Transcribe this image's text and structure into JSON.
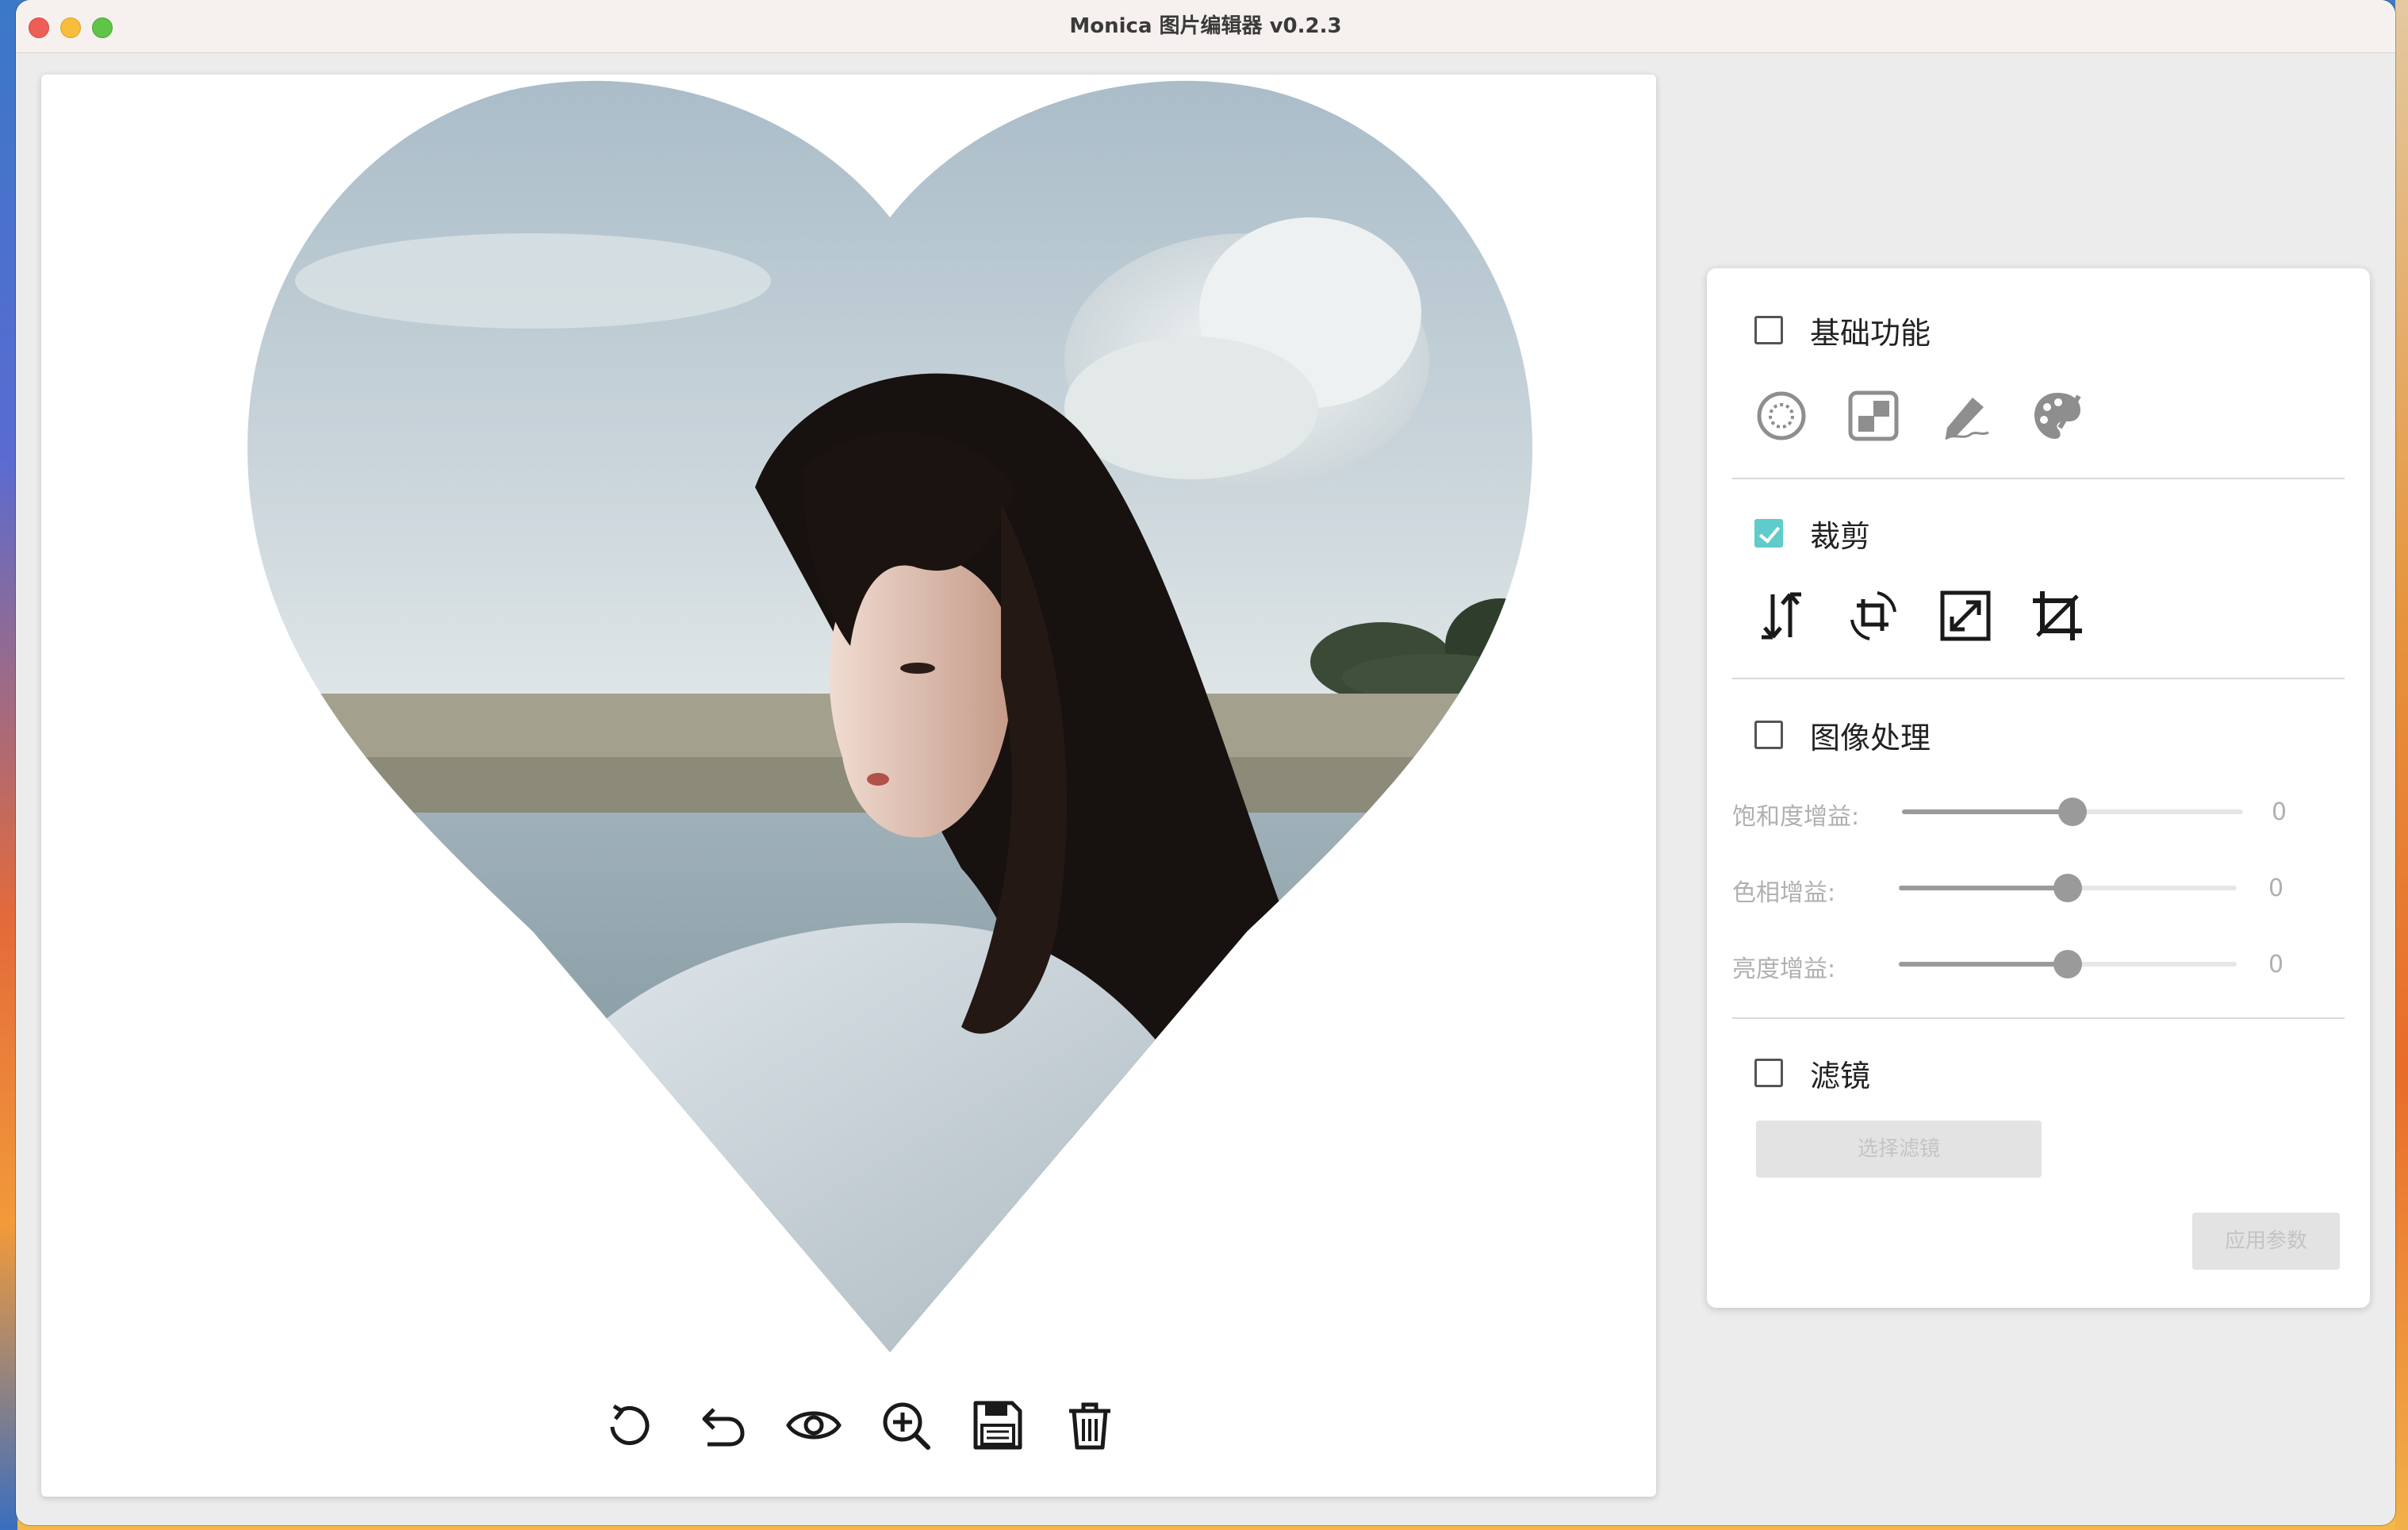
{
  "window": {
    "title": "Monica 图片编辑器 v0.2.3"
  },
  "canvas": {
    "image_subject": "heart-cropped portrait",
    "toolbar": [
      {
        "name": "rotate-icon"
      },
      {
        "name": "undo-icon"
      },
      {
        "name": "preview-eye-icon"
      },
      {
        "name": "zoom-in-icon"
      },
      {
        "name": "save-icon"
      },
      {
        "name": "delete-icon"
      }
    ]
  },
  "panel": {
    "basic": {
      "label": "基础功能",
      "checked": false,
      "icons": [
        "blur-circle-icon",
        "mosaic-icon",
        "pen-brush-icon",
        "palette-icon"
      ]
    },
    "crop": {
      "label": "裁剪",
      "checked": true,
      "icons": [
        "flip-icon",
        "rotate-crop-icon",
        "resize-icon",
        "crop-icon"
      ]
    },
    "image_processing": {
      "label": "图像处理",
      "checked": false,
      "sliders": [
        {
          "label": "饱和度增益:",
          "value": "0",
          "position": 0.5
        },
        {
          "label": "色相增益:",
          "value": "0",
          "position": 0.5
        },
        {
          "label": "亮度增益:",
          "value": "0",
          "position": 0.5
        }
      ]
    },
    "filter": {
      "label": "滤镜",
      "checked": false,
      "select_label": "选择滤镜"
    },
    "apply_label": "应用参数"
  },
  "colors": {
    "accent_checkbox": "#5fcccb",
    "slider_thumb": "#9a9a9a",
    "panel_bg": "#ffffff",
    "window_bg": "#ececec"
  }
}
